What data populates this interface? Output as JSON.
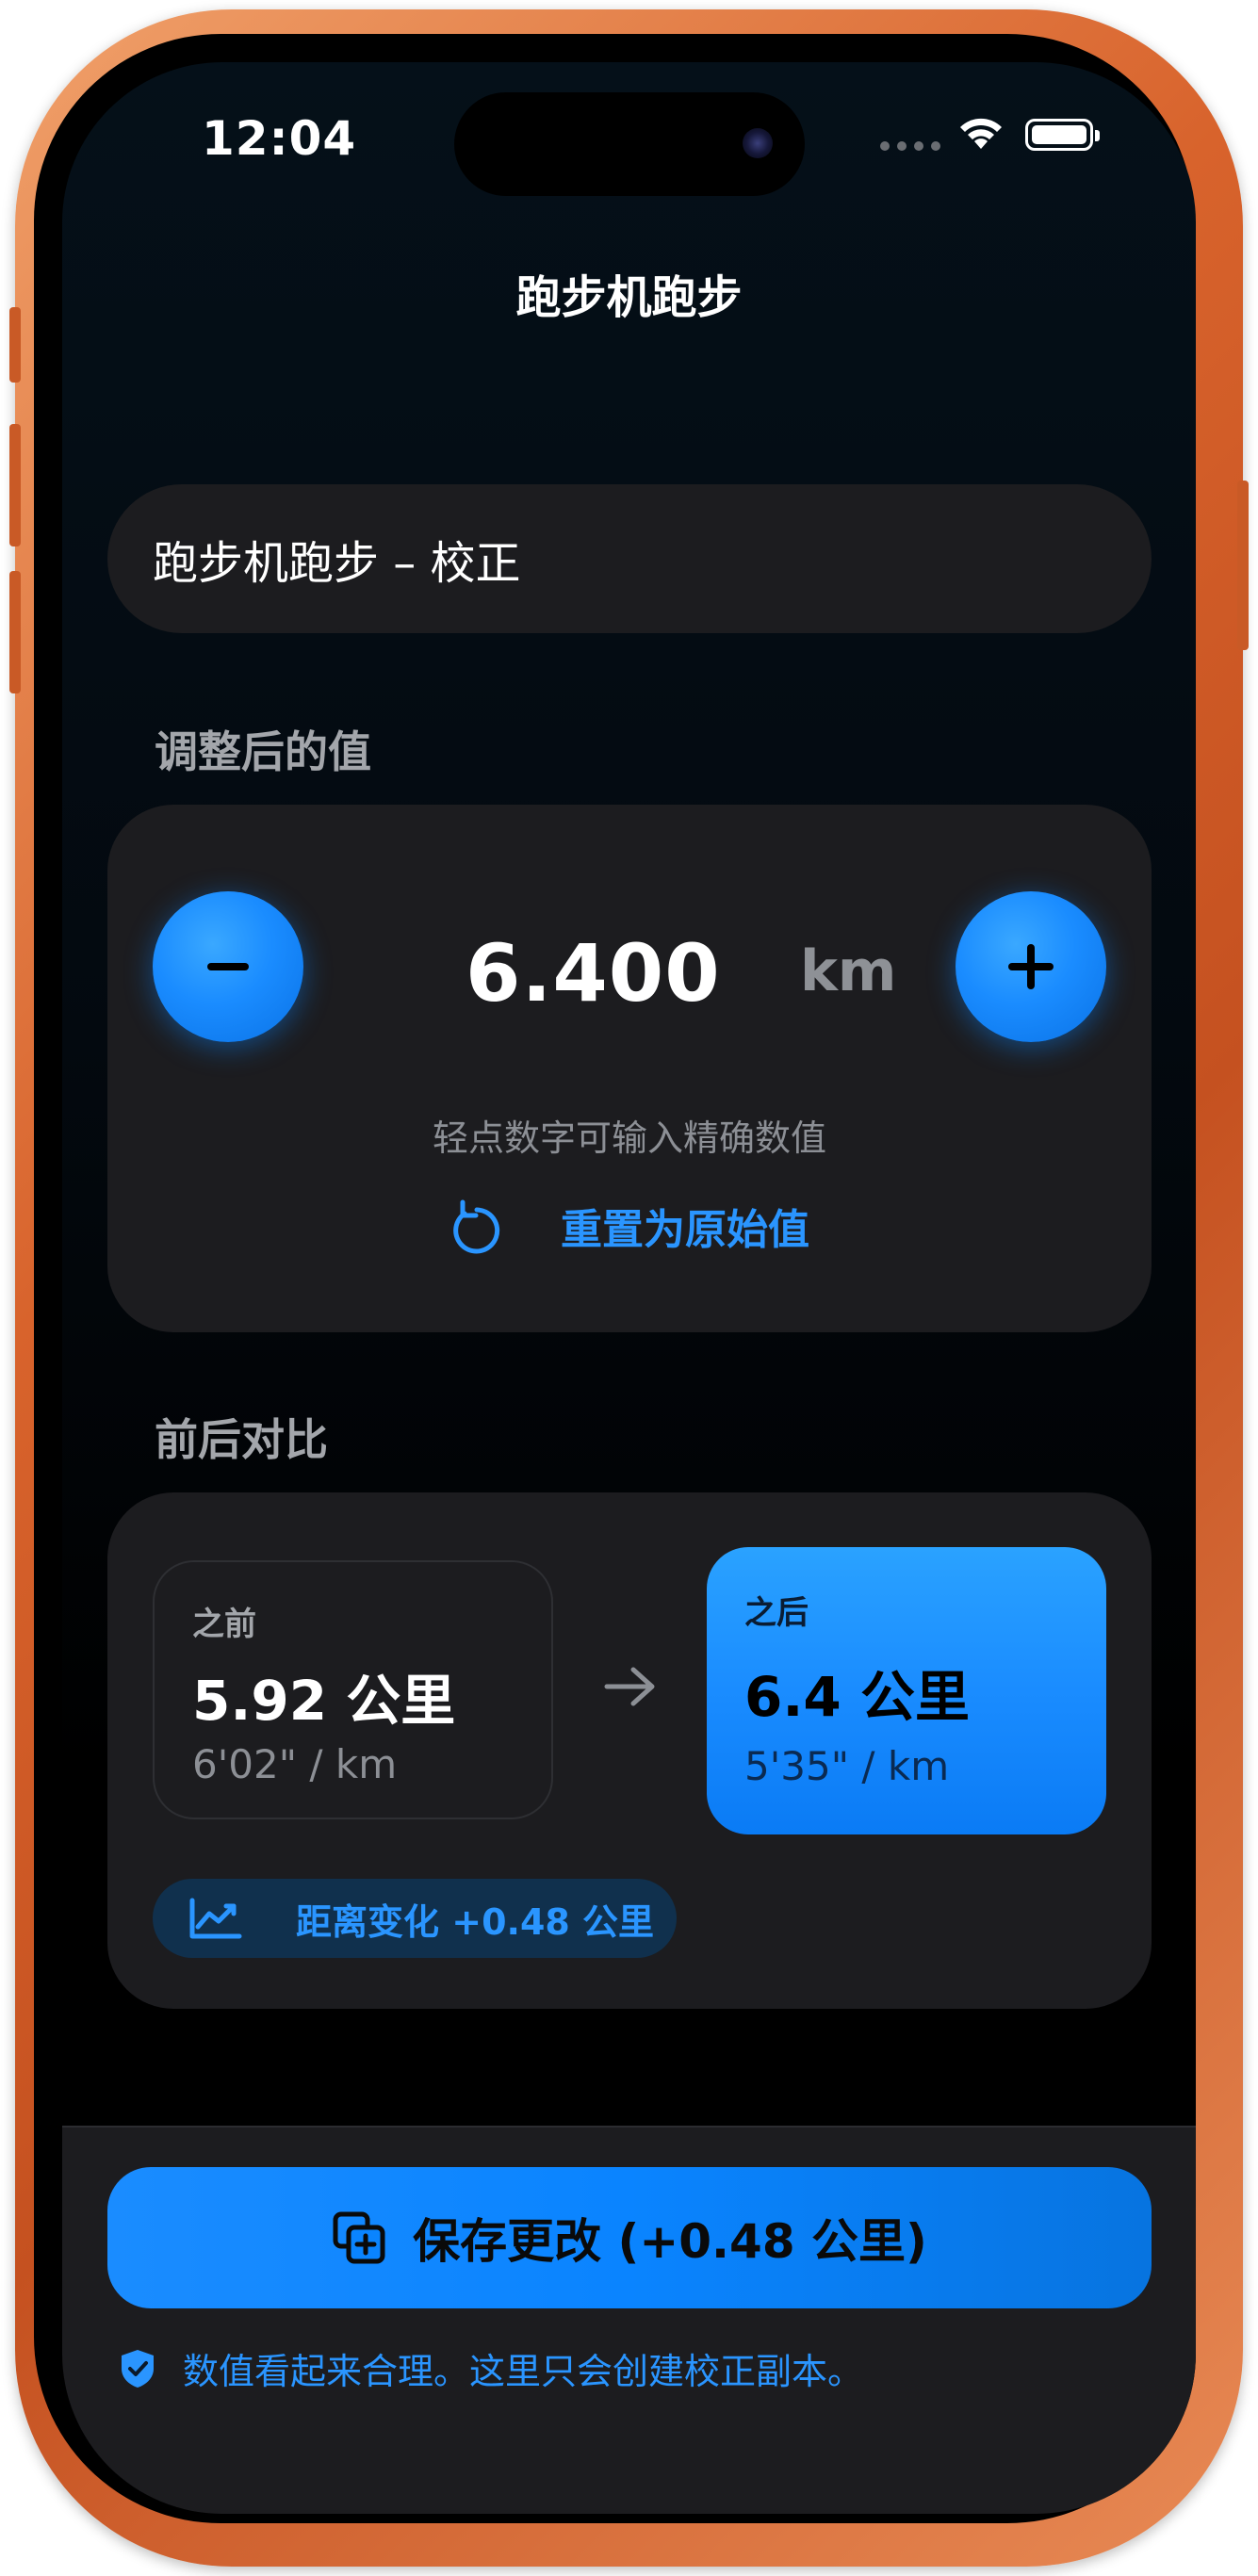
{
  "status_bar": {
    "time": "12:04"
  },
  "nav": {
    "title": "跑步机跑步"
  },
  "name_field": {
    "value": "跑步机跑步 – 校正"
  },
  "adjust_section": {
    "label": "调整后的值",
    "value": "6.400",
    "unit": "km",
    "hint": "轻点数字可输入精确数值",
    "reset_label": "重置为原始值"
  },
  "compare_section": {
    "label": "前后对比",
    "before": {
      "label": "之前",
      "value": "5.92 公里",
      "pace": "6'02\" / km"
    },
    "after": {
      "label": "之后",
      "value": "6.4 公里",
      "pace": "5'35\" / km"
    },
    "change_label": "距离变化 +0.48 公里"
  },
  "bottom": {
    "save_label": "保存更改 (+0.48 公里)",
    "note": "数值看起来合理。这里只会创建校正副本。"
  },
  "colors": {
    "accent": "#0a84ff",
    "background": "#000000",
    "card": "#1c1c1f",
    "frame": "#d8632c"
  },
  "icons": [
    "wifi-icon",
    "battery-icon",
    "minus-icon",
    "plus-icon",
    "reset-icon",
    "arrow-right-icon",
    "trend-icon",
    "copy-plus-icon",
    "shield-check-icon"
  ]
}
